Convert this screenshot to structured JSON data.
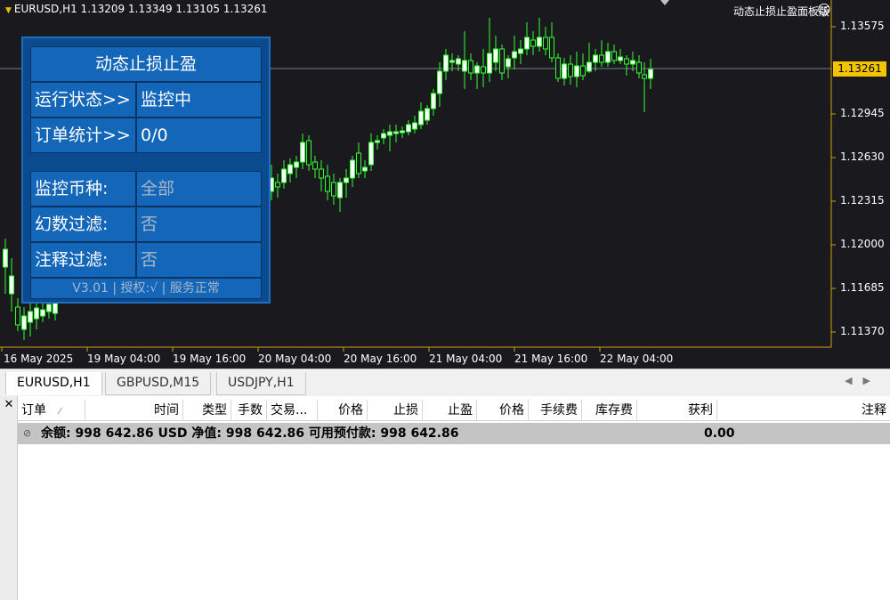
{
  "chart": {
    "header": "EURUSD,H1  1.13209 1.13349 1.13105 1.13261",
    "ea_name": "动态止损止盈面板版",
    "smiley_icon": "smiley-icon",
    "current_price": "1.13261",
    "price_labels": [
      "1.13575",
      "1.12945",
      "1.12630",
      "1.12315",
      "1.12000",
      "1.11685",
      "1.11370"
    ],
    "time_labels": [
      "16 May 2025",
      "19 May 04:00",
      "19 May 16:00",
      "20 May 04:00",
      "20 May 16:00",
      "21 May 04:00",
      "21 May 16:00",
      "22 May 04:00"
    ],
    "colors": {
      "background": "#1a1a1e",
      "candle": "#32ff32",
      "price_tag": "#f5c400",
      "axis": "#d4a017"
    }
  },
  "panel": {
    "title": "动态止损止盈",
    "run_status_label": "运行状态>>",
    "run_status_value": "监控中",
    "order_stats_label": "订单统计>>",
    "order_stats_value": "0/0",
    "symbol_label": "监控币种:",
    "symbol_value": "全部",
    "magic_label": "幻数过滤:",
    "magic_value": "否",
    "comment_label": "注释过滤:",
    "comment_value": "否",
    "footer": "V3.01 | 授权:√ | 服务正常"
  },
  "tabs": [
    {
      "label": "EURUSD,H1",
      "active": true
    },
    {
      "label": "GBPUSD,M15",
      "active": false
    },
    {
      "label": "USDJPY,H1",
      "active": false
    }
  ],
  "terminal": {
    "columns": [
      "订单",
      "时间",
      "类型",
      "手数",
      "交易...",
      "价格",
      "止损",
      "止盈",
      "价格",
      "手续费",
      "库存费",
      "获利",
      "注释"
    ],
    "sort_marker": "⁄",
    "balance_text": "余额: 998 642.86 USD  净值: 998 642.86  可用预付款: 998 642.86",
    "profit": "0.00"
  }
}
